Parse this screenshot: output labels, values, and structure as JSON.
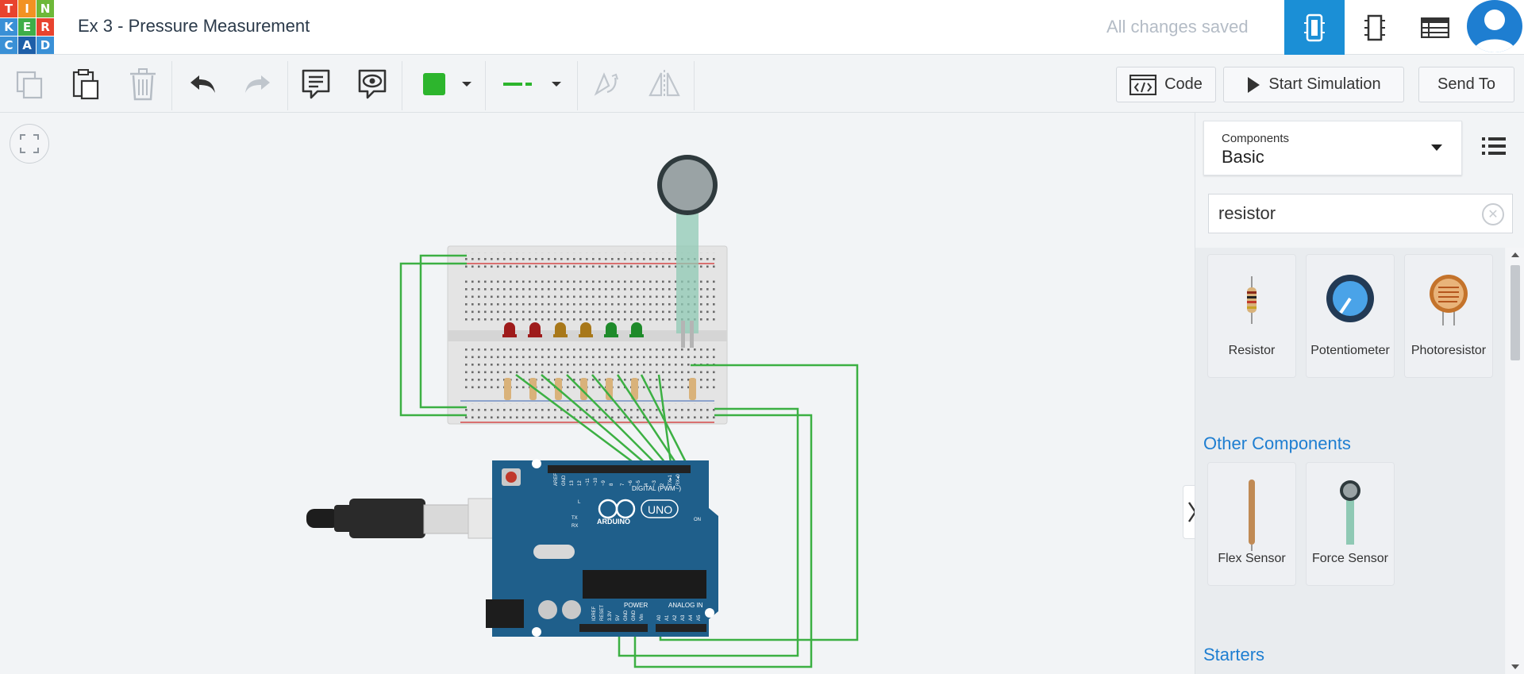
{
  "logo": {
    "letters": [
      "T",
      "I",
      "N",
      "K",
      "E",
      "R",
      "C",
      "A",
      "D"
    ]
  },
  "header": {
    "title": "Ex 3 - Pressure Measurement",
    "status": "All changes saved",
    "view_buttons": [
      "circuit-view-icon",
      "schematic-view-icon",
      "component-list-icon"
    ],
    "active_view": "circuit-view-icon"
  },
  "toolbar": {
    "icons": [
      "copy-icon",
      "paste-icon",
      "delete-icon",
      "undo-icon",
      "redo-icon",
      "notes-icon",
      "view-notes-icon",
      "wire-color-swatch",
      "wire-style-selector",
      "rotate-icon",
      "flip-icon"
    ],
    "wire_color": "#2db52d",
    "code_label": "Code",
    "simulate_label": "Start Simulation",
    "send_label": "Send To"
  },
  "panel": {
    "components_label": "Components",
    "components_value": "Basic",
    "search_value": "resistor",
    "results": [
      {
        "name": "Resistor"
      },
      {
        "name": "Potentiometer"
      },
      {
        "name": "Photoresistor"
      }
    ],
    "other_title": "Other Components",
    "other": [
      {
        "name": "Flex Sensor"
      },
      {
        "name": "Force Sensor"
      }
    ],
    "starters_title": "Starters"
  },
  "circuit": {
    "leds": [
      "#9e1b1b",
      "#9e1b1b",
      "#a8781a",
      "#a8781a",
      "#1e8a2a",
      "#1e8a2a"
    ],
    "board": {
      "labels": [
        "UNO",
        "ARDUINO",
        "DIGITAL (PWM~)",
        "POWER",
        "ANALOG IN",
        "ON",
        "AREF",
        "GND",
        "~11",
        "~10",
        "~9",
        "~6",
        "~5",
        "~3",
        "TX",
        "RX",
        "A0",
        "A1",
        "A2",
        "A3",
        "A4",
        "A5",
        "IOREF",
        "RESET",
        "3.3V",
        "5V",
        "Vin",
        "L",
        "13",
        "12",
        "8",
        "7",
        "4",
        "2",
        "TX▸1",
        "RX◂0"
      ]
    },
    "wire_color": "#3cb043",
    "board_color": "#1f5f8b"
  }
}
